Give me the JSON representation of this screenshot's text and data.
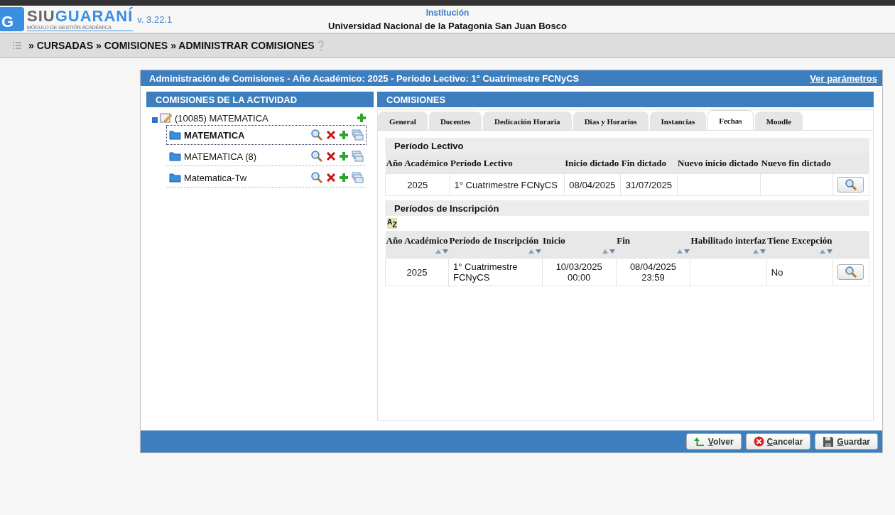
{
  "header": {
    "logo_letter": "G",
    "brand_a": "SIU",
    "brand_b": "GUARANÍ",
    "brand_sub": "MÓDULO DE GESTIÓN ACADÉMICA",
    "version": "v. 3.22.1",
    "institution_label": "Institución",
    "institution": "Universidad Nacional de la Patagonia San Juan Bosco"
  },
  "breadcrumb": [
    "» CURSADAS",
    "» COMISIONES",
    "» ADMINISTRAR COMISIONES"
  ],
  "panel": {
    "title": "Administración de Comisiones - Año Académico: 2025 - Período Lectivo: 1° Cuatrimestre FCNyCS",
    "link": "Ver parámetros"
  },
  "tree": {
    "title": "COMISIONES DE LA ACTIVIDAD",
    "root": {
      "label": "(10085) MATEMATICA",
      "expanded": true,
      "children": [
        {
          "label": "MATEMATICA",
          "selected": true
        },
        {
          "label": "MATEMATICA (8)",
          "selected": false
        },
        {
          "label": "Matematica-Tw",
          "selected": false
        }
      ]
    }
  },
  "comisiones": {
    "title": "COMISIONES",
    "tabs": [
      {
        "label": "General",
        "selected": false
      },
      {
        "label": "Docentes",
        "selected": false
      },
      {
        "label": "Dedicación Horaria",
        "selected": false
      },
      {
        "label": "Dias y Horarios",
        "selected": false
      },
      {
        "label": "Instancias",
        "selected": false
      },
      {
        "label": "Fechas",
        "selected": true
      },
      {
        "label": "Moodle",
        "selected": false
      }
    ],
    "lectivo": {
      "title": "Período Lectivo",
      "columns": [
        "Año Académico",
        "Período Lectivo",
        "Inicio dictado",
        "Fin dictado",
        "Nuevo inicio dictado",
        "Nuevo fin dictado"
      ],
      "rows": [
        [
          "2025",
          "1° Cuatrimestre FCNyCS",
          "08/04/2025",
          "31/07/2025",
          "",
          ""
        ]
      ]
    },
    "inscripcion": {
      "title": "Períodos de Inscripción",
      "sort_label_a": "A",
      "sort_label_b": "Z",
      "columns": [
        {
          "label": "Año Académico"
        },
        {
          "label": "Período de Inscripción"
        },
        {
          "label": "Inicio"
        },
        {
          "label": "Fin"
        },
        {
          "label": "Habilitado interfaz"
        },
        {
          "label": "Tiene Excepción"
        }
      ],
      "rows": [
        [
          "2025",
          "1° Cuatrimestre FCNyCS",
          "10/03/2025 00:00",
          "08/04/2025 23:59",
          "",
          "No"
        ]
      ]
    }
  },
  "buttons": [
    {
      "label": "Volver",
      "kind": "back"
    },
    {
      "label": "Cancelar",
      "kind": "cancel"
    },
    {
      "label": "Guardar",
      "kind": "save"
    }
  ]
}
